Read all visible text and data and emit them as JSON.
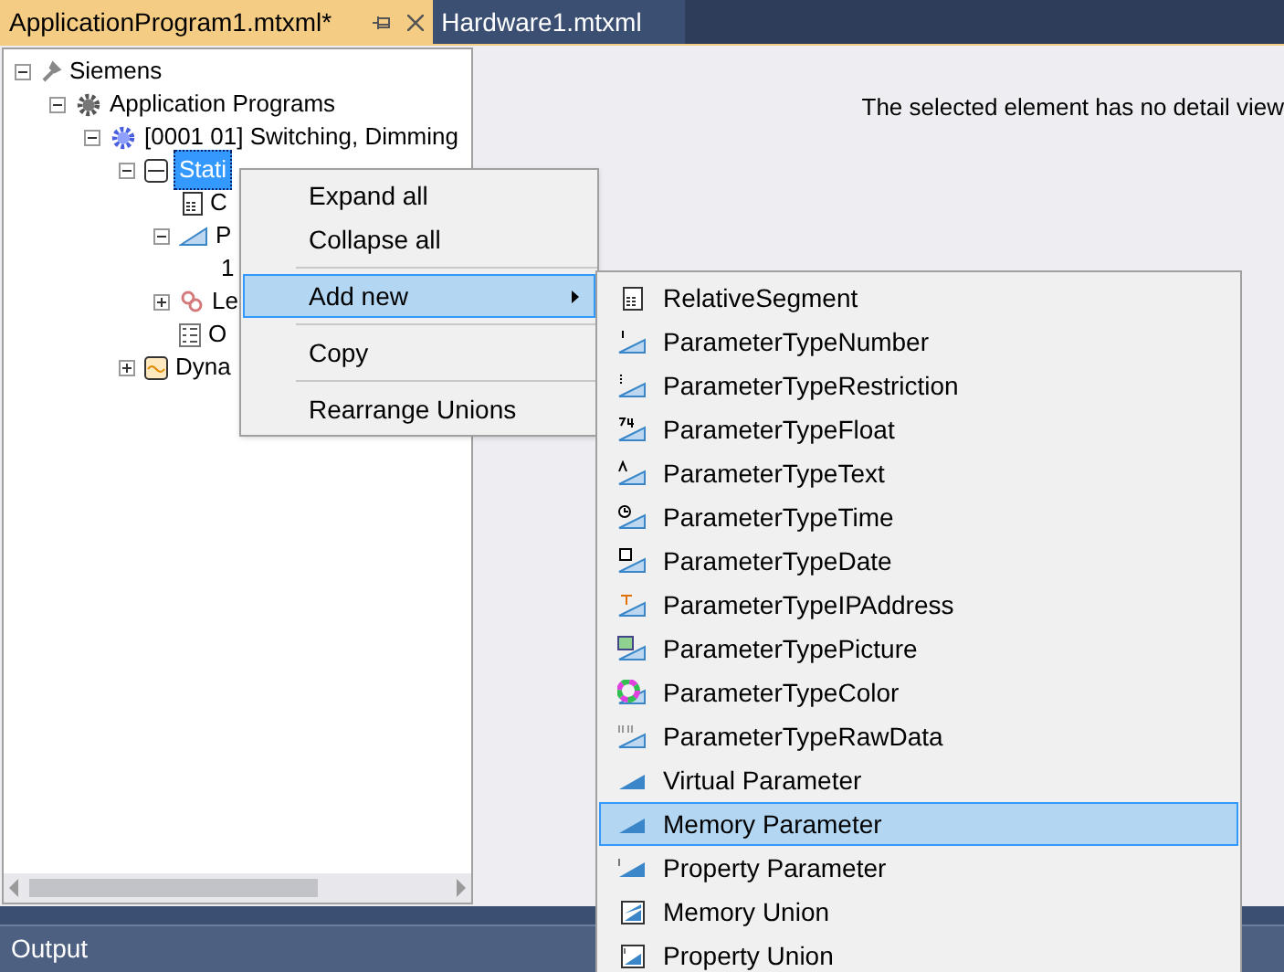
{
  "tabs": [
    {
      "label": "ApplicationProgram1.mtxml*",
      "selected": true
    },
    {
      "label": "Hardware1.mtxml",
      "selected": false
    }
  ],
  "tree": [
    {
      "label": "Siemens",
      "expanded": true,
      "selected": false,
      "children": [
        {
          "label": "Application Programs",
          "expanded": true,
          "selected": false,
          "children": [
            {
              "label": "[0001 01] Switching, Dimming",
              "expanded": true,
              "selected": false,
              "children": [
                {
                  "label": "Stati",
                  "expanded": true,
                  "selected": true,
                  "children": [
                    {
                      "label": "C",
                      "selected": false
                    },
                    {
                      "label": "P",
                      "expanded": true,
                      "selected": false,
                      "children": [
                        {
                          "label": "1",
                          "selected": false
                        }
                      ]
                    },
                    {
                      "label": "Le",
                      "expanded": false,
                      "selected": false
                    },
                    {
                      "label": "O",
                      "selected": false
                    }
                  ]
                },
                {
                  "label": "Dyna",
                  "expanded": false,
                  "selected": false
                }
              ]
            }
          ]
        }
      ]
    }
  ],
  "detail_message": "The selected element has no detail view",
  "context_menu": [
    {
      "kind": "item",
      "label": "Expand all",
      "selected": false
    },
    {
      "kind": "item",
      "label": "Collapse all",
      "selected": false
    },
    {
      "kind": "separator"
    },
    {
      "kind": "submenu",
      "label": "Add new",
      "selected": true
    },
    {
      "kind": "separator"
    },
    {
      "kind": "item",
      "label": "Copy",
      "selected": false
    },
    {
      "kind": "separator"
    },
    {
      "kind": "item",
      "label": "Rearrange Unions",
      "selected": false
    }
  ],
  "submenu": [
    {
      "label": "RelativeSegment",
      "selected": false
    },
    {
      "label": "ParameterTypeNumber",
      "selected": false
    },
    {
      "label": "ParameterTypeRestriction",
      "selected": false
    },
    {
      "label": "ParameterTypeFloat",
      "selected": false
    },
    {
      "label": "ParameterTypeText",
      "selected": false
    },
    {
      "label": "ParameterTypeTime",
      "selected": false
    },
    {
      "label": "ParameterTypeDate",
      "selected": false
    },
    {
      "label": "ParameterTypeIPAddress",
      "selected": false
    },
    {
      "label": "ParameterTypePicture",
      "selected": false
    },
    {
      "label": "ParameterTypeColor",
      "selected": false
    },
    {
      "label": "ParameterTypeRawData",
      "selected": false
    },
    {
      "label": "Virtual Parameter",
      "selected": false
    },
    {
      "label": "Memory Parameter",
      "selected": true
    },
    {
      "label": "Property Parameter",
      "selected": false
    },
    {
      "label": "Memory Union",
      "selected": false
    },
    {
      "label": "Property Union",
      "selected": false
    }
  ],
  "output_panel": {
    "title": "Output"
  }
}
